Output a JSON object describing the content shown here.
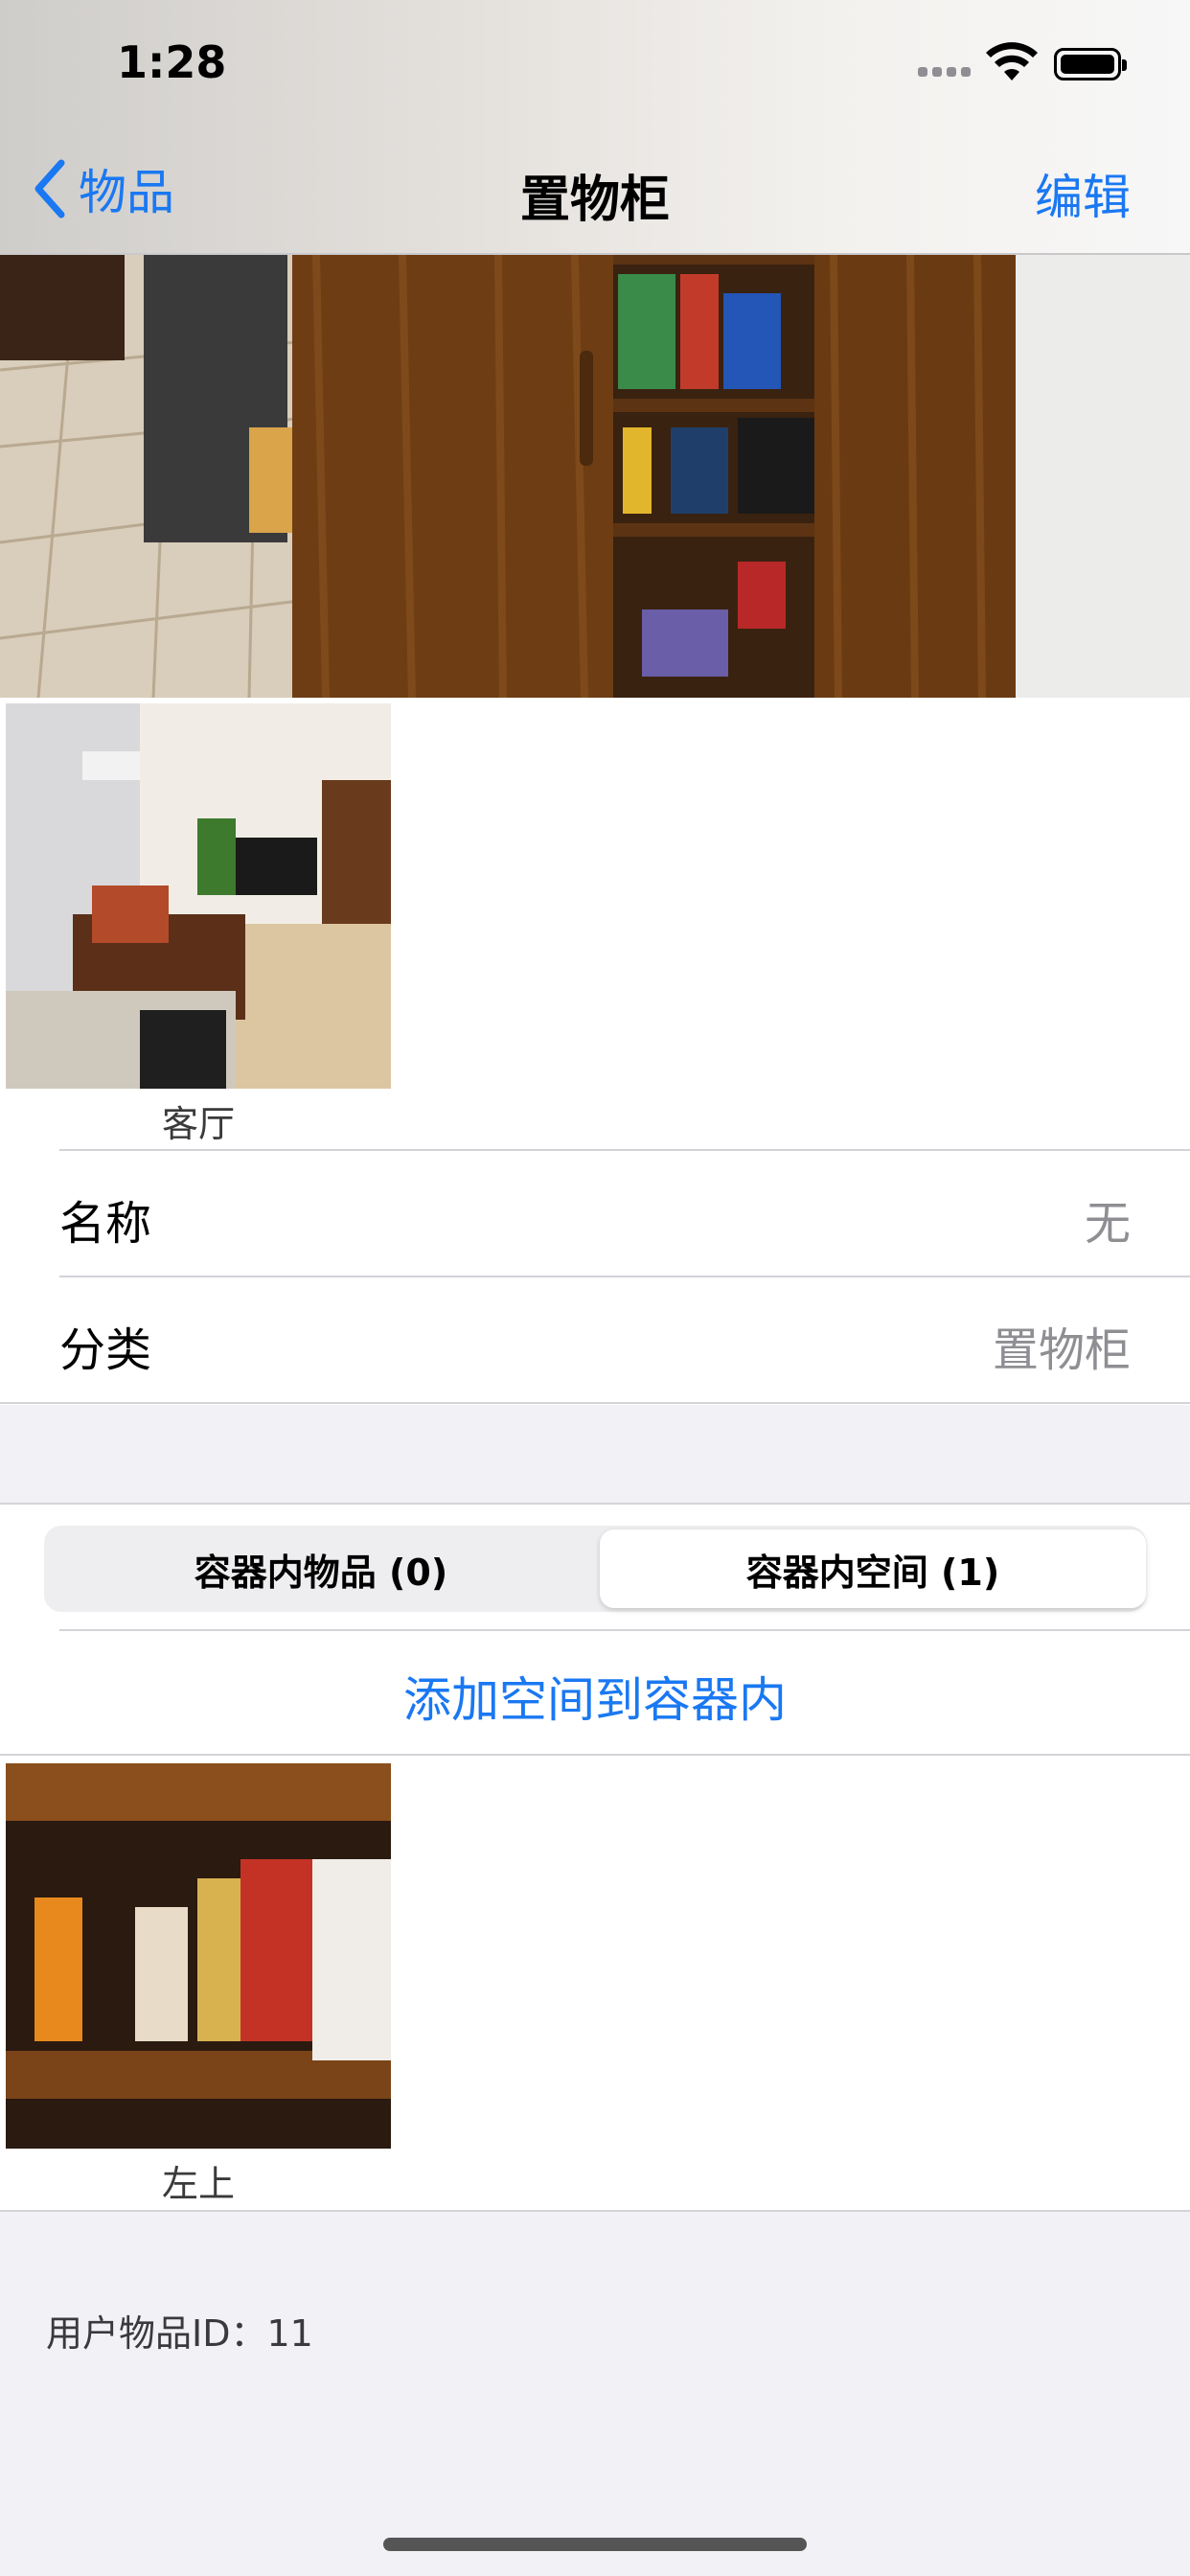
{
  "status_bar": {
    "time": "1:28"
  },
  "nav": {
    "back_label": "物品",
    "title": "置物柜",
    "edit_label": "编辑"
  },
  "location": {
    "caption": "客厅"
  },
  "fields": [
    {
      "label": "名称",
      "value": "无"
    },
    {
      "label": "分类",
      "value": "置物柜"
    }
  ],
  "segments": [
    {
      "label": "容器内物品 (0)",
      "active": false
    },
    {
      "label": "容器内空间 (1)",
      "active": true
    }
  ],
  "add_space_label": "添加空间到容器内",
  "spaces": [
    {
      "caption": "左上"
    }
  ],
  "footer": {
    "user_item_id": "用户物品ID：11"
  },
  "colors": {
    "accent": "#1a78f2",
    "secondary_text": "#8e8e93",
    "grouped_bg": "#f1f1f6"
  }
}
